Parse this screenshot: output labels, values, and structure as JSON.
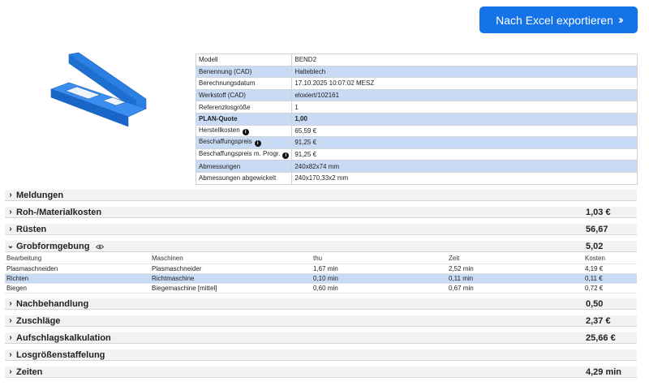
{
  "export_button": {
    "label": "Nach Excel exportieren",
    "icon": "double-chevron-right-icon"
  },
  "info": [
    {
      "key": "Modell",
      "value": "BEND2",
      "alt": false,
      "bold": false,
      "info": false
    },
    {
      "key": "Benennung (CAD)",
      "value": "Halteblech",
      "alt": true,
      "bold": false,
      "info": false
    },
    {
      "key": "Berechnungsdatum",
      "value": "17.10.2025 10:07:02 MESZ",
      "alt": false,
      "bold": false,
      "info": false
    },
    {
      "key": "Werkstoff (CAD)",
      "value": "eloxiert/102161",
      "alt": true,
      "bold": false,
      "info": false
    },
    {
      "key": "Referenzlosgröße",
      "value": "1",
      "alt": false,
      "bold": false,
      "info": false
    },
    {
      "key": "PLAN-Quote",
      "value": "1,00",
      "alt": true,
      "bold": true,
      "info": false
    },
    {
      "key": "Herstellkosten",
      "value": "65,59 €",
      "alt": false,
      "bold": false,
      "info": true
    },
    {
      "key": "Beschaffungspreis",
      "value": "91,25 €",
      "alt": true,
      "bold": false,
      "info": true
    },
    {
      "key": "Beschaffungspreis m. Progr.",
      "value": "91,25 €",
      "alt": false,
      "bold": false,
      "info": true
    },
    {
      "key": "Abmessungen",
      "value": "240x82x74 mm",
      "alt": true,
      "bold": false,
      "info": false
    },
    {
      "key": "Abmessungen abgewickelt",
      "value": "240x170,33x2 mm",
      "alt": false,
      "bold": false,
      "info": false
    }
  ],
  "sections": {
    "meldungen": {
      "label": "Meldungen",
      "value": ""
    },
    "material": {
      "label": "Roh-/Materialkosten",
      "value": "1,03 €"
    },
    "ruesten": {
      "label": "Rüsten",
      "value": "56,67"
    },
    "grobformgebung": {
      "label": "Grobformgebung",
      "value": "5,02"
    },
    "nachbehandlung": {
      "label": "Nachbehandlung",
      "value": "0,50"
    },
    "zuschlaege": {
      "label": "Zuschläge",
      "value": "2,37 €"
    },
    "aufschlag": {
      "label": "Aufschlagskalkulation",
      "value": "25,66 €"
    },
    "losgroessen": {
      "label": "Losgrößenstaffelung",
      "value": ""
    },
    "zeiten": {
      "label": "Zeiten",
      "value": "4,29 min"
    }
  },
  "grob_table": {
    "headers": [
      "Bearbeitung",
      "Maschinen",
      "thu",
      "Zeit",
      "Kosten"
    ],
    "rows": [
      [
        "Plasmaschneiden",
        "Plasmaschneider",
        "1,67 min",
        "2,52 min",
        "4,19 €"
      ],
      [
        "Richten",
        "Richtmaschine",
        "0,10 min",
        "0,11 min",
        "0,11 €"
      ],
      [
        "Biegen",
        "Biegemaschine [mittel]",
        "0,60 min",
        "0,67 min",
        "0,72 €"
      ]
    ]
  },
  "colors": {
    "accent": "#1473e6",
    "row_highlight": "#c9daf4",
    "part_blue": "#1e73d8"
  }
}
